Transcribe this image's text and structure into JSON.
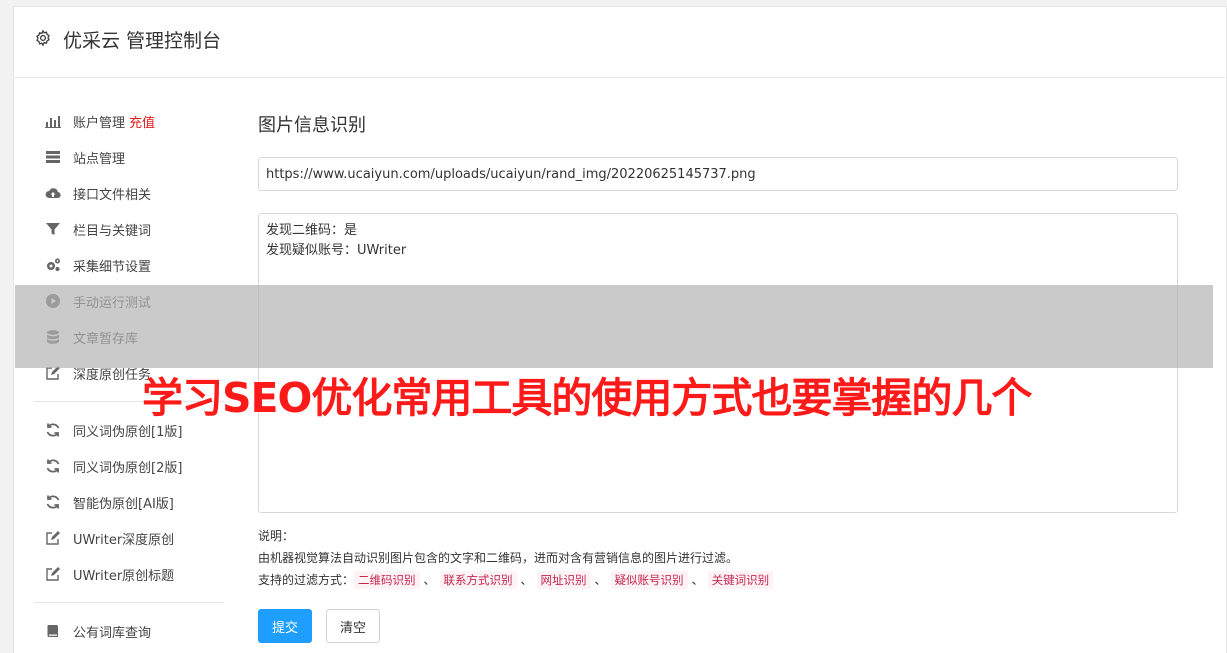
{
  "header": {
    "title": "优采云 管理控制台",
    "icon": "gear-icon"
  },
  "sidebar": {
    "group1": [
      {
        "label": "账户管理",
        "badge": "充值",
        "icon": "bar-chart-icon"
      },
      {
        "label": "站点管理",
        "icon": "server-icon"
      },
      {
        "label": "接口文件相关",
        "icon": "cloud-upload-icon"
      },
      {
        "label": "栏目与关键词",
        "icon": "filter-icon"
      },
      {
        "label": "采集细节设置",
        "icon": "gears-icon"
      },
      {
        "label": "手动运行测试",
        "icon": "play-circle-icon"
      },
      {
        "label": "文章暂存库",
        "icon": "database-icon"
      },
      {
        "label": "深度原创任务",
        "icon": "edit-icon"
      }
    ],
    "group2": [
      {
        "label": "同义词伪原创[1版]",
        "icon": "refresh-icon"
      },
      {
        "label": "同义词伪原创[2版]",
        "icon": "refresh-icon"
      },
      {
        "label": "智能伪原创[AI版]",
        "icon": "refresh-icon"
      },
      {
        "label": "UWriter深度原创",
        "icon": "edit-icon"
      },
      {
        "label": "UWriter原创标题",
        "icon": "edit-icon"
      }
    ],
    "group3": [
      {
        "label": "公有词库查询",
        "icon": "book-icon"
      }
    ]
  },
  "main": {
    "title": "图片信息识别",
    "url_value": "https://www.ucaiyun.com/uploads/ucaiyun/rand_img/20220625145737.png",
    "result_lines": [
      "发现二维码：是",
      "发现疑似账号：UWriter"
    ],
    "notes": {
      "heading": "说明：",
      "description": "由机器视觉算法自动识别图片包含的文字和二维码，进而对含有营销信息的图片进行过滤。",
      "filter_prefix": "支持的过滤方式：",
      "tags": [
        "二维码识别",
        "联系方式识别",
        "网址识别",
        "疑似账号识别",
        "关键词识别"
      ],
      "separator": "、"
    },
    "submit_label": "提交",
    "clear_label": "清空"
  },
  "overlay": {
    "text": "学习SEO优化常用工具的使用方式也要掌握的几个"
  },
  "colors": {
    "primary": "#1e9fff",
    "badge": "#e21b1b",
    "tag_text": "#c7254e",
    "overlay_text": "#ff1a1a"
  }
}
